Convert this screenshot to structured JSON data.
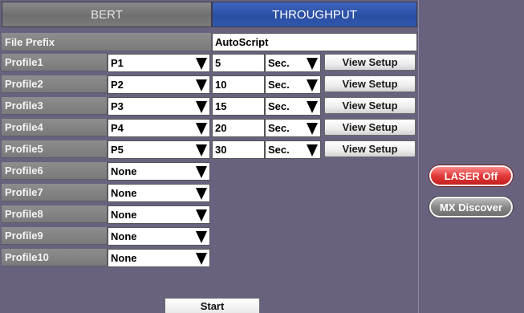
{
  "tabs": [
    {
      "label": "BERT",
      "active": false
    },
    {
      "label": "THROUGHPUT",
      "active": true
    }
  ],
  "file_prefix": {
    "label": "File Prefix",
    "value": "AutoScript"
  },
  "profiles": [
    {
      "label": "Profile1",
      "value": "P1",
      "duration": "5",
      "unit": "Sec.",
      "view_label": "View Setup"
    },
    {
      "label": "Profile2",
      "value": "P2",
      "duration": "10",
      "unit": "Sec.",
      "view_label": "View Setup"
    },
    {
      "label": "Profile3",
      "value": "P3",
      "duration": "15",
      "unit": "Sec.",
      "view_label": "View Setup"
    },
    {
      "label": "Profile4",
      "value": "P4",
      "duration": "20",
      "unit": "Sec.",
      "view_label": "View Setup"
    },
    {
      "label": "Profile5",
      "value": "P5",
      "duration": "30",
      "unit": "Sec.",
      "view_label": "View Setup"
    },
    {
      "label": "Profile6",
      "value": "None"
    },
    {
      "label": "Profile7",
      "value": "None"
    },
    {
      "label": "Profile8",
      "value": "None"
    },
    {
      "label": "Profile9",
      "value": "None"
    },
    {
      "label": "Profile10",
      "value": "None"
    }
  ],
  "buttons": {
    "start": "Start",
    "laser": "LASER Off",
    "mx_discover": "MX Discover"
  },
  "colors": {
    "background": "#68627e",
    "active_tab": "#2b4fa3",
    "inactive_tab": "#7b7b7b",
    "laser_button": "#e23a3a",
    "mx_button": "#888888"
  }
}
